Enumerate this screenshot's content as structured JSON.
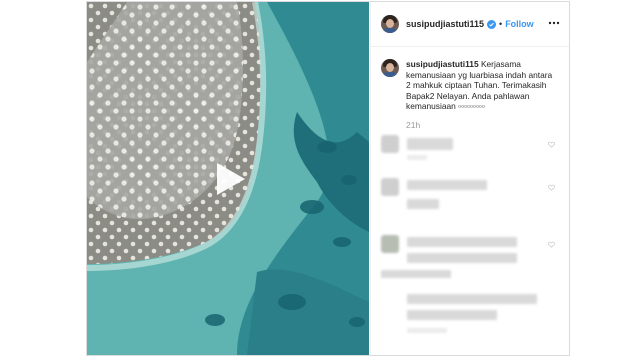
{
  "post": {
    "username": "susipudjiastuti115",
    "separator": "•",
    "follow_label": "Follow",
    "caption_username": "susipudjiastuti115",
    "caption_text": "Kerjasama kemanusiaan yg luarbiasa indah antara 2 mahkuk ciptaan Tuhan. Terimakasih Bapak2 Nelayan. Anda pahlawan kemanusiaan ▫▫▫▫▫▫▫▫▫",
    "time": "21h"
  },
  "icons": {
    "play": "play-icon",
    "verified": "verified-badge-icon",
    "more": "more-options-icon",
    "like": "heart-icon"
  },
  "colors": {
    "follow": "#3897f0",
    "verified": "#3897f0",
    "text": "#262626",
    "muted": "#999999",
    "border": "#dbdbdb"
  }
}
